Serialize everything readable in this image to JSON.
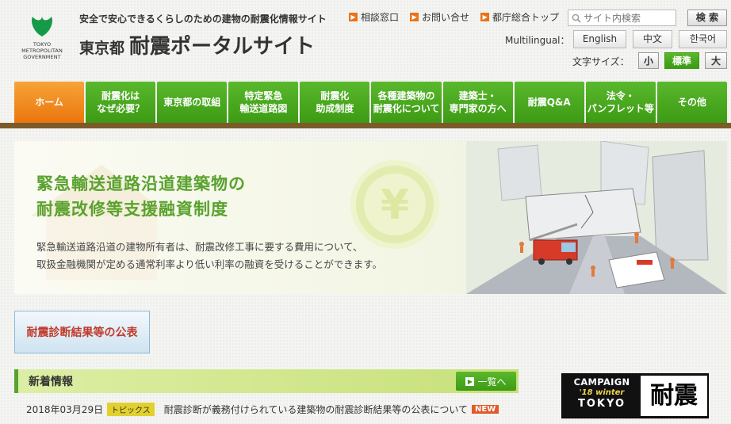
{
  "header": {
    "logo_text": [
      "TOKYO",
      "METROPOLITAN",
      "GOVERNMENT"
    ],
    "tagline": "安全で安心できるくらしのための建物の耐震化情報サイト",
    "title_sub": "東京都",
    "title_main": "耐震ポータルサイト",
    "links": [
      "相談窓口",
      "お問い合せ",
      "都庁総合トップ"
    ],
    "search_placeholder": "サイト内検索",
    "search_button": "検 索",
    "multilingual_label": "Multilingual：",
    "languages": [
      "English",
      "中文",
      "한국어"
    ],
    "font_size_label": "文字サイズ：",
    "font_sizes": [
      "小",
      "標準",
      "大"
    ]
  },
  "nav": {
    "items": [
      "ホーム",
      "耐震化は\nなぜ必要？",
      "東京都の取組",
      "特定緊急\n輸送道路図",
      "耐震化\n助成制度",
      "各種建築物の\n耐震化について",
      "建築士・\n専門家の方へ",
      "耐震Q&A",
      "法令・\nパンフレット等",
      "その他"
    ],
    "active_index": 0
  },
  "hero": {
    "title_line1": "緊急輸送道路沿道建築物の",
    "title_line2": "耐震改修等支援融資制度",
    "desc_line1": "緊急輸送道路沿道の建物所有者は、耐震改修工事に要する費用について、",
    "desc_line2": "取扱金融機関が定める通常利率より低い利率の融資を受けることができます。"
  },
  "banner": {
    "label": "耐震診断結果等の公表"
  },
  "news": {
    "heading": "新着情報",
    "all_button": "一覧へ",
    "items": [
      {
        "date": "2018年03月29日",
        "tag": "トピックス",
        "text": "耐震診断が義務付けられている建築物の耐震診断結果等の公表について",
        "badge": "NEW"
      }
    ]
  },
  "campaign": {
    "line1": "CAMPAIGN",
    "line2": "'18 winter",
    "line3": "TOKYO",
    "kanji": "耐震"
  },
  "colors": {
    "nav_green": "#4caf23",
    "nav_active_orange": "#f08a1e",
    "hero_title_green": "#5aa22e",
    "brown_bar": "#7c5a2a",
    "new_badge": "#e05a2b"
  }
}
